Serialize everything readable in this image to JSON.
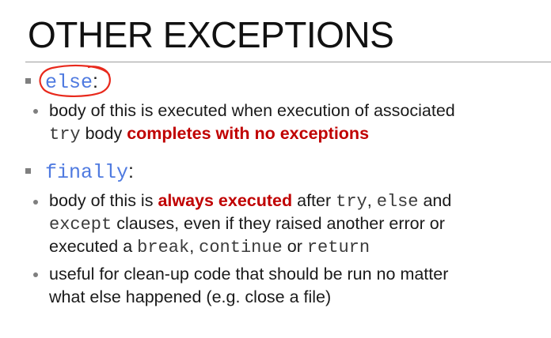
{
  "slide": {
    "title": "OTHER EXCEPTIONS",
    "highlight_color": "#c00000",
    "keyword_color": "#4f7ae0",
    "annotation_color": "#e8291c"
  },
  "else_section": {
    "keyword": "else",
    "suffix": ":",
    "line1": "body of this is executed when execution of associated",
    "line2_code": "try",
    "line2_text": " body ",
    "line2_highlight": "completes with no exceptions"
  },
  "finally_section": {
    "keyword": "finally",
    "suffix": ":",
    "b1_l1_pre": "body of this is ",
    "b1_l1_highlight": "always executed",
    "b1_l1_mid": " after ",
    "b1_l1_code1": "try",
    "b1_l1_comma": ", ",
    "b1_l1_code2": "else",
    "b1_l1_and": " and",
    "b1_l2_code": "except",
    "b1_l2_text": " clauses, even if they raised another error or",
    "b1_l3_pre": "executed a ",
    "b1_l3_code1": "break",
    "b1_l3_comma": ", ",
    "b1_l3_code2": "continue",
    "b1_l3_or": " or ",
    "b1_l3_code3": "return",
    "b2_l1": "useful for clean-up code that should be run no matter",
    "b2_l2": "what else happened (e.g. close a file)"
  }
}
